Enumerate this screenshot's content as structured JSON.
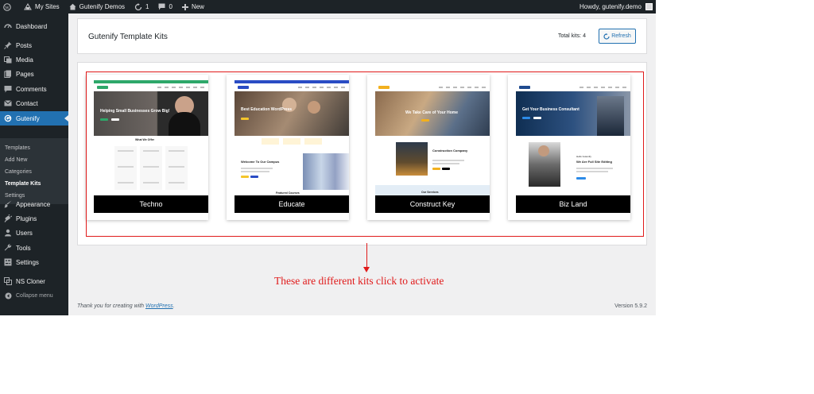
{
  "admin_bar": {
    "items": [
      {
        "label": "",
        "icon": "wordpress-logo-icon"
      },
      {
        "label": "My Sites",
        "icon": "my-sites-icon"
      },
      {
        "label": "Gutenify Demos",
        "icon": "home-icon"
      },
      {
        "label": "1",
        "icon": "updates-icon"
      },
      {
        "label": "0",
        "icon": "comment-icon"
      },
      {
        "label": "New",
        "icon": "plus-icon"
      }
    ],
    "greeting": "Howdy, gutenify.demo"
  },
  "sidebar": {
    "items": [
      {
        "label": "Dashboard",
        "icon": "dashboard-icon"
      },
      {
        "label": "Posts",
        "icon": "pin-icon"
      },
      {
        "label": "Media",
        "icon": "media-icon"
      },
      {
        "label": "Pages",
        "icon": "pages-icon"
      },
      {
        "label": "Comments",
        "icon": "comment-icon"
      },
      {
        "label": "Contact",
        "icon": "mail-icon"
      },
      {
        "label": "Gutenify",
        "icon": "gutenify-icon",
        "active": true
      },
      {
        "label": "Appearance",
        "icon": "brush-icon"
      },
      {
        "label": "Plugins",
        "icon": "plug-icon"
      },
      {
        "label": "Users",
        "icon": "users-icon"
      },
      {
        "label": "Tools",
        "icon": "wrench-icon"
      },
      {
        "label": "Settings",
        "icon": "settings-icon"
      },
      {
        "label": "NS Cloner",
        "icon": "cloner-icon"
      }
    ],
    "submenu": [
      {
        "label": "Templates"
      },
      {
        "label": "Add New"
      },
      {
        "label": "Categories"
      },
      {
        "label": "Template Kits",
        "current": true
      },
      {
        "label": "Settings"
      }
    ],
    "collapse_label": "Collapse menu"
  },
  "header": {
    "title": "Gutenify Template Kits",
    "total_label": "Total kits:",
    "total_value": "4",
    "refresh_label": "Refresh"
  },
  "kits": [
    {
      "name": "Techno",
      "hero_text": "Helping Small Businesses Grow Big!",
      "section_text": "What We Offer"
    },
    {
      "name": "Educate",
      "hero_text": "Best Education WordPress",
      "section_text": "Welcome To Our Campus",
      "footer_text": "Featured Courses"
    },
    {
      "name": "Construct Key",
      "hero_text": "We Take Care of Your Home",
      "section_text": "Construction Company",
      "footer_text": "Our Services"
    },
    {
      "name": "Biz Land",
      "hero_text": "Get Your Business Consultant",
      "section_text": "We Are Full Site Editing",
      "sub_text": "Hello Gutenify"
    }
  ],
  "annotation": "These are different kits click to activate",
  "footer": {
    "thanks_prefix": "Thank you for creating with ",
    "thanks_link": "WordPress",
    "thanks_suffix": ".",
    "version": "Version 5.9.2"
  },
  "colors": {
    "admin_dark": "#1d2327",
    "accent_blue": "#2271b1",
    "annotation_red": "#e01a1a"
  }
}
